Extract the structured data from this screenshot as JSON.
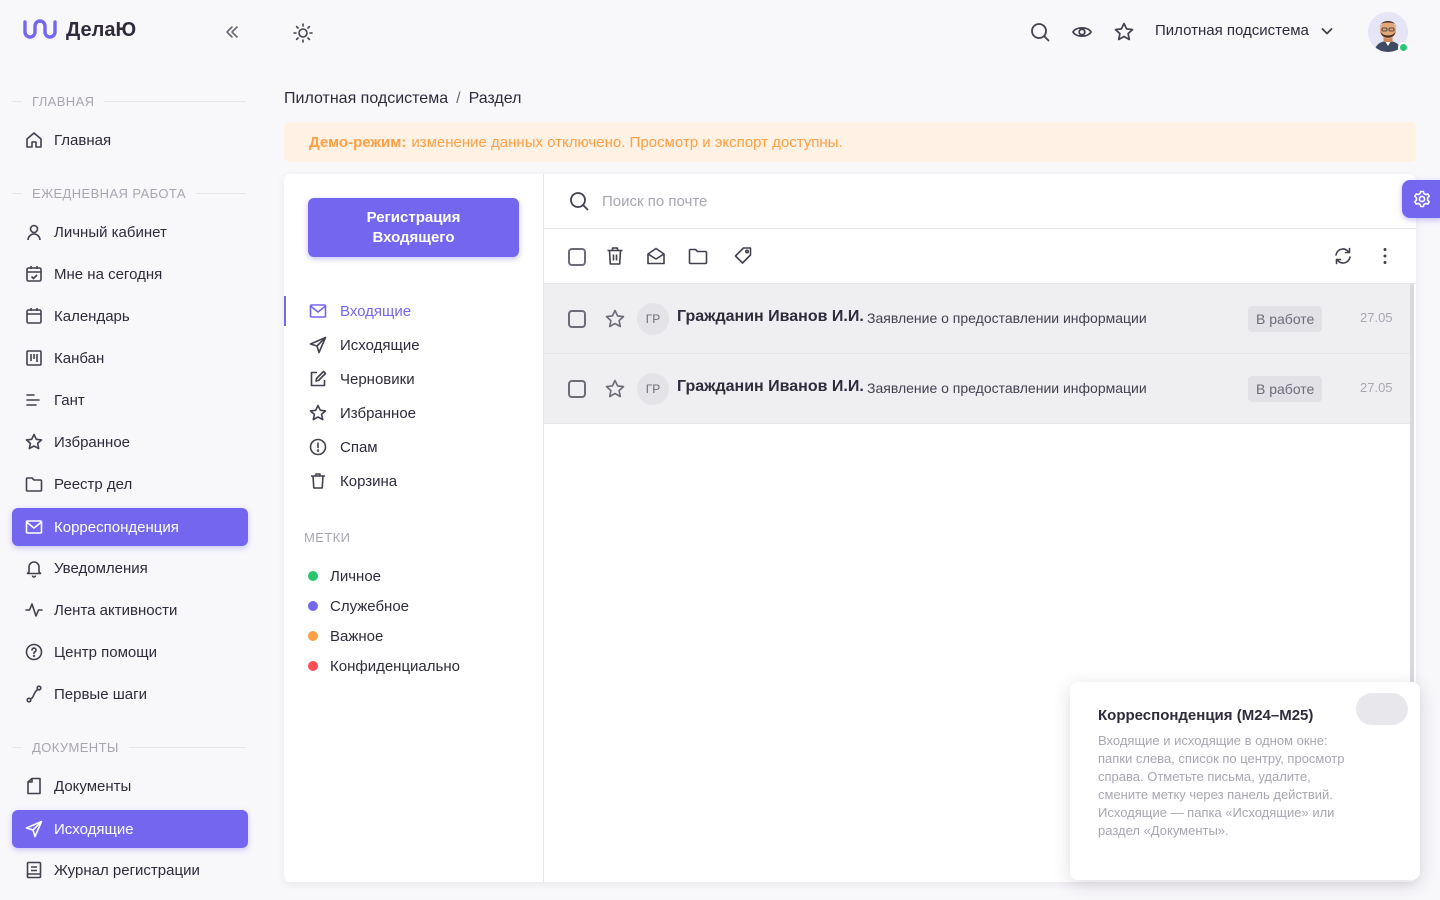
{
  "brand": {
    "name": "ДелаЮ"
  },
  "sidebar": {
    "sections": [
      {
        "title": "ГЛАВНАЯ"
      },
      {
        "title": "ЕЖЕДНЕВНАЯ РАБОТА"
      },
      {
        "title": "ДОКУМЕНТЫ"
      }
    ],
    "items": [
      {
        "label": "Главная",
        "icon": "home-icon"
      },
      {
        "label": "Личный кабинет",
        "icon": "user-icon"
      },
      {
        "label": "Мне на сегодня",
        "icon": "calendar-check-icon"
      },
      {
        "label": "Календарь",
        "icon": "calendar-icon"
      },
      {
        "label": "Канбан",
        "icon": "kanban-icon"
      },
      {
        "label": "Гант",
        "icon": "gantt-icon"
      },
      {
        "label": "Избранное",
        "icon": "star-icon"
      },
      {
        "label": "Реестр дел",
        "icon": "folder-icon"
      },
      {
        "label": "Корреспонденция",
        "icon": "mail-icon",
        "active": true
      },
      {
        "label": "Уведомления",
        "icon": "bell-icon"
      },
      {
        "label": "Лента активности",
        "icon": "activity-icon"
      },
      {
        "label": "Центр помощи",
        "icon": "help-icon"
      },
      {
        "label": "Первые шаги",
        "icon": "route-icon"
      },
      {
        "label": "Документы",
        "icon": "document-icon"
      },
      {
        "label": "Исходящие",
        "icon": "send-icon",
        "active": true
      },
      {
        "label": "Журнал регистрации",
        "icon": "journal-icon"
      }
    ]
  },
  "topbar": {
    "system": "Пилотная подсистема"
  },
  "breadcrumb": {
    "root": "Пилотная подсистема",
    "sep": "/",
    "current": "Раздел"
  },
  "banner": {
    "bold": "Демо-режим:",
    "text": "изменение данных отключено. Просмотр и экспорт доступны."
  },
  "mail": {
    "compose_label": "Регистрация Входящего",
    "folders": [
      {
        "label": "Входящие",
        "icon": "mail-icon",
        "active": true
      },
      {
        "label": "Исходящие",
        "icon": "send-icon"
      },
      {
        "label": "Черновики",
        "icon": "edit-icon"
      },
      {
        "label": "Избранное",
        "icon": "star-icon"
      },
      {
        "label": "Спам",
        "icon": "alert-circle-icon"
      },
      {
        "label": "Корзина",
        "icon": "trash-icon"
      }
    ],
    "labels_title": "МЕТКИ",
    "labels": [
      {
        "label": "Личное",
        "color": "#28c76f"
      },
      {
        "label": "Служебное",
        "color": "#7367f0"
      },
      {
        "label": "Важное",
        "color": "#ff9f43"
      },
      {
        "label": "Конфиденциально",
        "color": "#ff4c51"
      }
    ],
    "search_placeholder": "Поиск по почте",
    "messages": [
      {
        "initials": "ГР",
        "sender": "Гражданин Иванов И.И.",
        "subject": "Заявление о предоставлении информации",
        "status": "В работе",
        "date": "27.05"
      },
      {
        "initials": "ГР",
        "sender": "Гражданин Иванов И.И.",
        "subject": "Заявление о предоставлении информации",
        "status": "В работе",
        "date": "27.05"
      }
    ]
  },
  "info": {
    "title": "Корреспонденция (M24–M25)",
    "text": "Входящие и исходящие в одном окне: папки слева, список по центру, просмотр справа. Отметьте письма, удалите, смените метку через панель действий. Исходящие — папка «Исходящие» или раздел «Документы»."
  },
  "colors": {
    "accent": "#7367f0",
    "warning_bg": "#fff1e3",
    "warning_text": "#ff9f43"
  }
}
